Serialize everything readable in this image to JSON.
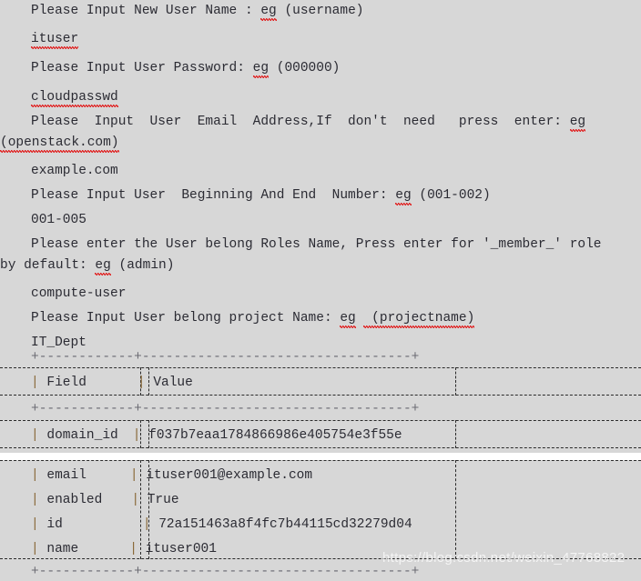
{
  "meta": {
    "background_color": "#d7d7d7",
    "text_color": "#2b2b33",
    "spellcheck_color": "#e02020",
    "table_pipe_color": "#8a6a3a",
    "selection_border_color": "#2a2a2a"
  },
  "console": {
    "lines": [
      {
        "id": "prompt-username",
        "kind": "prompt",
        "text": "Please Input New User Name : ",
        "example_word": "eg",
        "example_rest": " (username)"
      },
      {
        "id": "input-username",
        "kind": "input",
        "text": "ituser",
        "misspelled": true
      },
      {
        "id": "prompt-password",
        "kind": "prompt",
        "text": "Please Input User Password: ",
        "example_word": "eg",
        "example_rest": " (000000)"
      },
      {
        "id": "input-password",
        "kind": "input",
        "text": "cloudpasswd",
        "misspelled": true
      },
      {
        "id": "prompt-email-a",
        "kind": "prompt",
        "text": "Please  Input  User  Email  Address,If  don't  need   press  enter: ",
        "example_word": "eg",
        "example_rest": ""
      },
      {
        "id": "prompt-email-b",
        "kind": "wrap",
        "text": "(openstack.com)",
        "misspelled": true
      },
      {
        "id": "input-email",
        "kind": "input",
        "text": "example.com"
      },
      {
        "id": "prompt-range",
        "kind": "prompt",
        "text": "Please Input User  Beginning And End  Number: ",
        "example_word": "eg",
        "example_rest": " (001-002)"
      },
      {
        "id": "input-range",
        "kind": "input",
        "text": "001-005"
      },
      {
        "id": "prompt-roles-a",
        "kind": "prompt",
        "text": "Please enter the User belong Roles Name, Press enter for '_member_' role"
      },
      {
        "id": "prompt-roles-b",
        "kind": "wrap",
        "text": "by default: ",
        "example_word": "eg",
        "example_rest": " (admin)"
      },
      {
        "id": "input-roles",
        "kind": "input",
        "text": "compute-user"
      },
      {
        "id": "prompt-project",
        "kind": "prompt",
        "text": "Please Input User belong project Name: ",
        "example_word": "eg",
        "example_rest2": " (projectname)"
      },
      {
        "id": "input-project",
        "kind": "input",
        "text": "IT_Dept"
      }
    ]
  },
  "result_table": {
    "border_top": "+------------+----------------------------------+",
    "border_middle": "+------------+----------------------------------+",
    "border_bottom": "+------------+----------------------------------+",
    "header": {
      "field": "Field",
      "value": "Value"
    },
    "rows": [
      {
        "field": "domain_id",
        "value": "f037b7eaa1784866986e405754e3f55e"
      },
      {
        "field": "email",
        "value": "ituser001@example.com"
      },
      {
        "field": "enabled",
        "value": "True"
      },
      {
        "field": "id",
        "value": "72a151463a8f4fc7b44115cd32279d04"
      },
      {
        "field": "name",
        "value": "ituser001"
      }
    ]
  },
  "watermark": {
    "text": "https://blog.csdn.net/weixin_47768822"
  }
}
